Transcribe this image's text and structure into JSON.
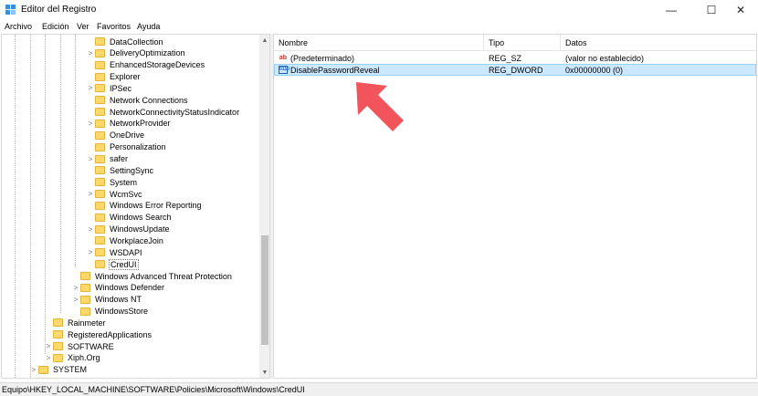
{
  "window": {
    "title": "Editor del Registro",
    "minimize": "—",
    "maximize": "☐",
    "close": "✕"
  },
  "menu": [
    "Archivo",
    "Edición",
    "Ver",
    "Favoritos",
    "Ayuda"
  ],
  "tree": [
    {
      "label": "DataCollection",
      "level": 4,
      "expander": ""
    },
    {
      "label": "DeliveryOptimization",
      "level": 4,
      "expander": ">"
    },
    {
      "label": "EnhancedStorageDevices",
      "level": 4,
      "expander": ""
    },
    {
      "label": "Explorer",
      "level": 4,
      "expander": ""
    },
    {
      "label": "IPSec",
      "level": 4,
      "expander": ">"
    },
    {
      "label": "Network Connections",
      "level": 4,
      "expander": ""
    },
    {
      "label": "NetworkConnectivityStatusIndicator",
      "level": 4,
      "expander": ""
    },
    {
      "label": "NetworkProvider",
      "level": 4,
      "expander": ">"
    },
    {
      "label": "OneDrive",
      "level": 4,
      "expander": ""
    },
    {
      "label": "Personalization",
      "level": 4,
      "expander": ""
    },
    {
      "label": "safer",
      "level": 4,
      "expander": ">"
    },
    {
      "label": "SettingSync",
      "level": 4,
      "expander": ""
    },
    {
      "label": "System",
      "level": 4,
      "expander": ""
    },
    {
      "label": "WcmSvc",
      "level": 4,
      "expander": ">"
    },
    {
      "label": "Windows Error Reporting",
      "level": 4,
      "expander": ""
    },
    {
      "label": "Windows Search",
      "level": 4,
      "expander": ""
    },
    {
      "label": "WindowsUpdate",
      "level": 4,
      "expander": ">"
    },
    {
      "label": "WorkplaceJoin",
      "level": 4,
      "expander": ""
    },
    {
      "label": "WSDAPI",
      "level": 4,
      "expander": ">"
    },
    {
      "label": "CredUI",
      "level": 4,
      "expander": "",
      "selected": true
    },
    {
      "label": "Windows Advanced Threat Protection",
      "level": 3,
      "expander": ""
    },
    {
      "label": "Windows Defender",
      "level": 3,
      "expander": ">"
    },
    {
      "label": "Windows NT",
      "level": 3,
      "expander": ">"
    },
    {
      "label": "WindowsStore",
      "level": 3,
      "expander": ""
    },
    {
      "label": "Rainmeter",
      "level": 2,
      "expander": ""
    },
    {
      "label": "RegisteredApplications",
      "level": 2,
      "expander": ""
    },
    {
      "label": "SOFTWARE",
      "level": 2,
      "expander": ">"
    },
    {
      "label": "Xiph.Org",
      "level": 2,
      "expander": ">"
    },
    {
      "label": "SYSTEM",
      "level": 1,
      "expander": ">"
    }
  ],
  "list": {
    "columns": [
      "Nombre",
      "Tipo",
      "Datos"
    ],
    "rows": [
      {
        "icon": "string-value-icon",
        "icon_glyph": "ab",
        "name": "(Predeterminado)",
        "type": "REG_SZ",
        "data": "(valor no establecido)",
        "selected": false
      },
      {
        "icon": "dword-value-icon",
        "icon_glyph": "0110",
        "name": "DisablePasswordReveal",
        "type": "REG_DWORD",
        "data": "0x00000000 (0)",
        "selected": true
      }
    ]
  },
  "status": "Equipo\\HKEY_LOCAL_MACHINE\\SOFTWARE\\Policies\\Microsoft\\Windows\\CredUI",
  "colors": {
    "accent_arrow": "#f2545b",
    "selection": "#cce8ff",
    "folder": "#ffd86b"
  }
}
